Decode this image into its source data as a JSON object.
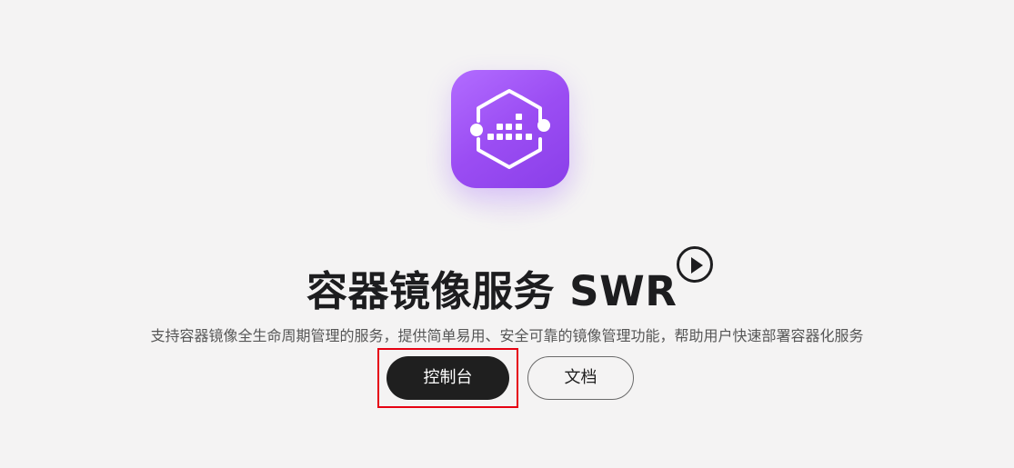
{
  "hero": {
    "title": "容器镜像服务 SWR",
    "description": "支持容器镜像全生命周期管理的服务，提供简单易用、安全可靠的镜像管理功能，帮助用户快速部署容器化服务",
    "icon": "container-registry-icon",
    "play_icon": "play-icon"
  },
  "actions": {
    "console_label": "控制台",
    "docs_label": "文档"
  },
  "colors": {
    "background": "#f4f3f3",
    "title": "#1d1d1f",
    "description": "#565656",
    "primary_button": "#1f1f1f",
    "highlight": "#e60012",
    "logo_gradient_start": "#b26cff",
    "logo_gradient_end": "#8a3fe9"
  }
}
